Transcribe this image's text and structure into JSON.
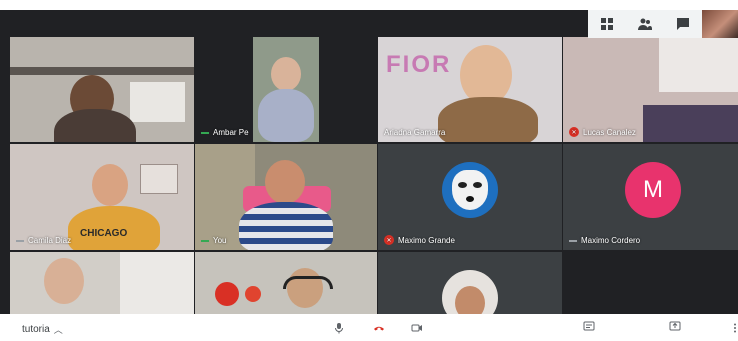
{
  "meeting": {
    "name": "tutoria"
  },
  "participants": [
    {
      "id": "p1",
      "name": "",
      "muted": false
    },
    {
      "id": "p2",
      "name": "Ambar Pe",
      "muted": false
    },
    {
      "id": "p3",
      "name": "Ariadna Gamarra",
      "muted": false
    },
    {
      "id": "p4",
      "name": "Lucas Canalez",
      "muted": true
    },
    {
      "id": "p5",
      "name": "Camila Diaz",
      "muted": false
    },
    {
      "id": "p6",
      "name": "You",
      "muted": false
    },
    {
      "id": "p7",
      "name": "Maximo Grande",
      "muted": true
    },
    {
      "id": "p8",
      "name": "Maximo Cordero",
      "muted": false,
      "initial": "M"
    },
    {
      "id": "p9",
      "name": "",
      "muted": false
    },
    {
      "id": "p10",
      "name": "",
      "muted": false
    },
    {
      "id": "p11",
      "name": "",
      "muted": false
    }
  ],
  "colors": {
    "avatar_m": "#e8336d",
    "end_call": "#d93025",
    "stage_bg": "#202124"
  },
  "icons": {
    "top": [
      "grid-icon",
      "people-icon",
      "chat-icon"
    ],
    "bottom": [
      "mic-icon",
      "end-call-icon",
      "camera-icon",
      "captions-icon",
      "present-icon",
      "more-icon"
    ]
  }
}
